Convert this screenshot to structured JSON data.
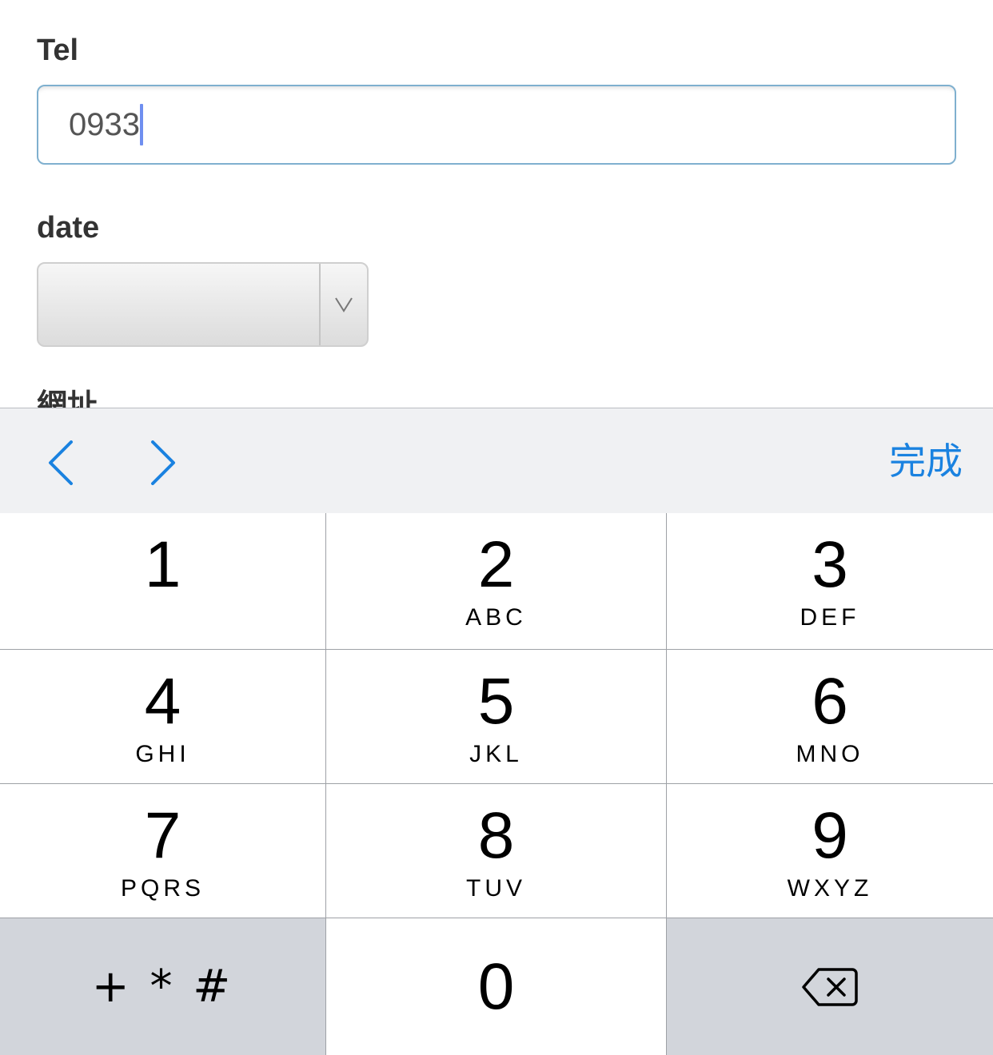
{
  "form": {
    "tel_label": "Tel",
    "tel_value": "0933",
    "date_label": "date",
    "date_value": "",
    "next_label_partial": "網址"
  },
  "accessory": {
    "prev_icon": "chevron-left-icon",
    "next_icon": "chevron-right-icon",
    "done_label": "完成",
    "accent_color": "#1a82e0"
  },
  "keypad": {
    "keys": [
      {
        "digit": "1",
        "letters": ""
      },
      {
        "digit": "2",
        "letters": "ABC"
      },
      {
        "digit": "3",
        "letters": "DEF"
      },
      {
        "digit": "4",
        "letters": "GHI"
      },
      {
        "digit": "5",
        "letters": "JKL"
      },
      {
        "digit": "6",
        "letters": "MNO"
      },
      {
        "digit": "7",
        "letters": "PQRS"
      },
      {
        "digit": "8",
        "letters": "TUV"
      },
      {
        "digit": "9",
        "letters": "WXYZ"
      }
    ],
    "symbols_label": "+ * #",
    "zero": "0",
    "delete_icon": "backspace-icon"
  }
}
